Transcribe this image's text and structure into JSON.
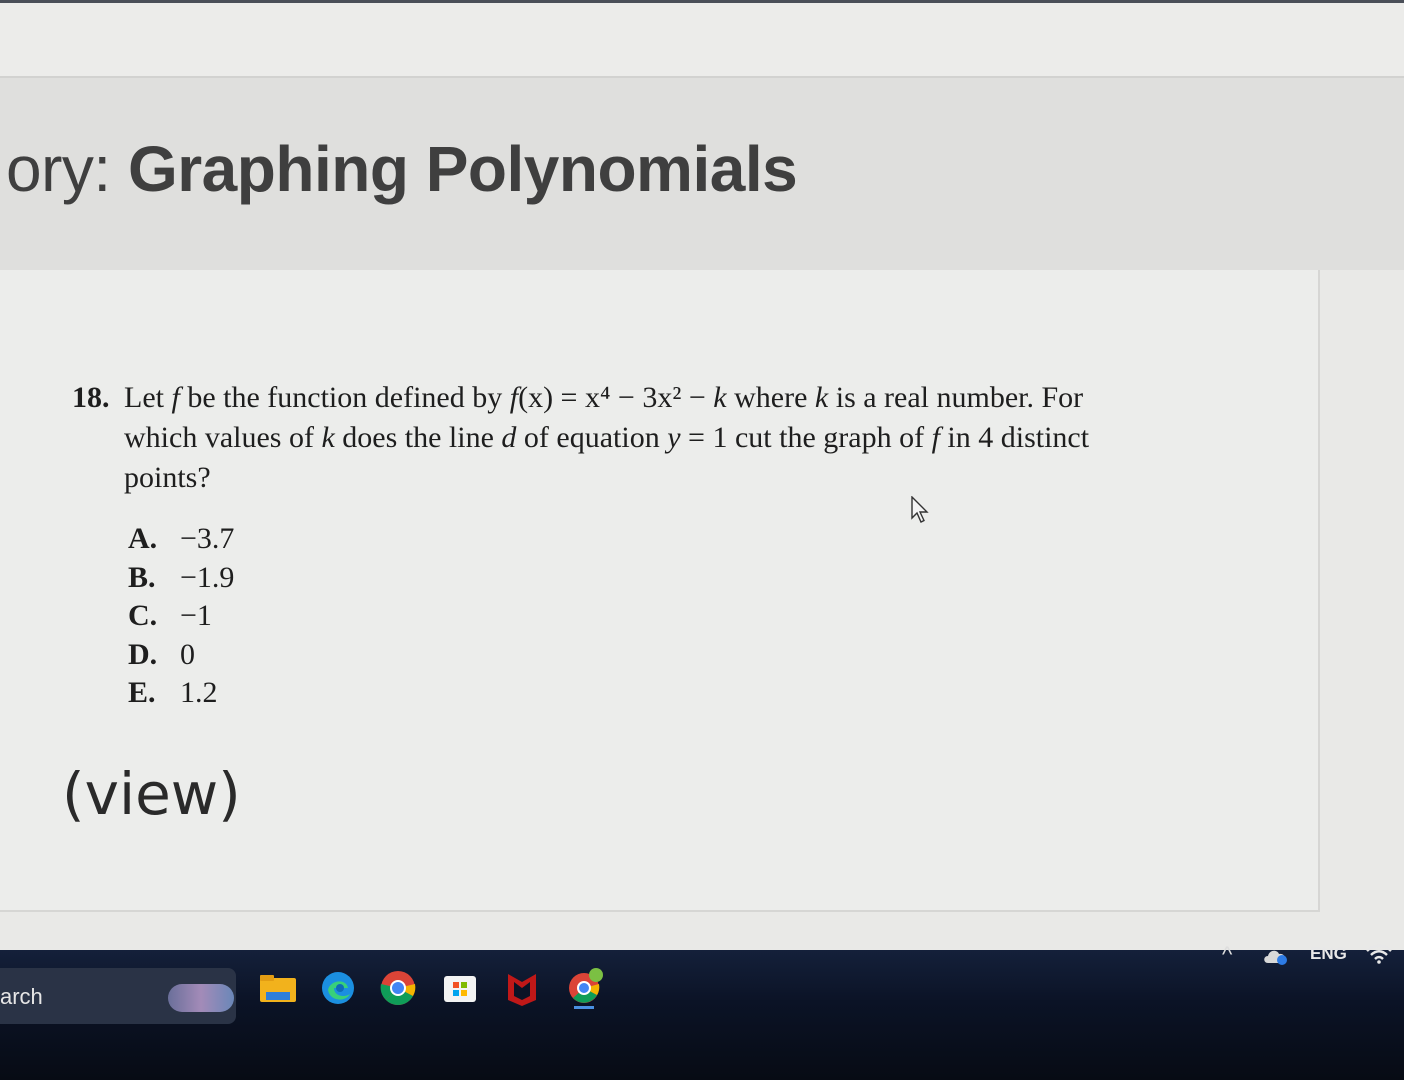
{
  "header": {
    "title_lead": "ory: ",
    "title_main": "Graphing Polynomials"
  },
  "question": {
    "number": "18.",
    "text_line1_a": "Let ",
    "text_line1_f": "f",
    "text_line1_b": " be the function defined by ",
    "text_line1_fx": "f",
    "text_line1_c": "(x) = x⁴ − 3x² − ",
    "text_line1_k": "k",
    "text_line1_d": " where ",
    "text_line1_k2": "k",
    "text_line1_e": " is a real number. For",
    "text_line2_a": "which values of ",
    "text_line2_k": "k",
    "text_line2_b": " does the line ",
    "text_line2_d": "d",
    "text_line2_c": " of equation ",
    "text_line2_y": "y",
    "text_line2_e": " = 1 cut the graph of ",
    "text_line2_f": "f",
    "text_line2_g": " in 4 distinct",
    "text_line3": "points?"
  },
  "options": [
    {
      "letter": "A.",
      "value": "−3.7"
    },
    {
      "letter": "B.",
      "value": "−1.9"
    },
    {
      "letter": "C.",
      "value": "−1"
    },
    {
      "letter": "D.",
      "value": "0"
    },
    {
      "letter": "E.",
      "value": "1.2"
    }
  ],
  "view_link": "(view)",
  "taskbar": {
    "search_label": "arch",
    "icons": [
      "file-explorer-icon",
      "edge-icon",
      "chrome-icon",
      "microsoft-store-icon",
      "mcafee-icon",
      "chrome-profile-icon"
    ],
    "tray": {
      "chevron": "^",
      "language": "ENG"
    }
  },
  "colors": {
    "title": "#3f3f3f",
    "taskbar": "#0b1326",
    "page_bg": "#e9e9e7"
  }
}
